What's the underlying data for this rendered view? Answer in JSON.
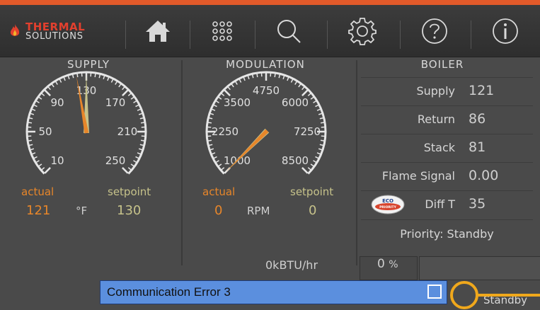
{
  "brand": {
    "line1": "THERMAL",
    "line2": "SOLUTIONS"
  },
  "nav": [
    {
      "name": "home-icon"
    },
    {
      "name": "apps-grid-icon"
    },
    {
      "name": "search-icon"
    },
    {
      "name": "gear-icon"
    },
    {
      "name": "help-icon"
    },
    {
      "name": "info-icon"
    }
  ],
  "supply": {
    "title": "SUPPLY",
    "ticks": [
      "10",
      "50",
      "90",
      "130",
      "170",
      "210",
      "250"
    ],
    "actual_label": "actual",
    "setpoint_label": "setpoint",
    "actual_value": "121",
    "unit": "°F",
    "setpoint_value": "130",
    "actual": 121,
    "setpoint": 130,
    "min": 10,
    "max": 250
  },
  "modulation": {
    "title": "MODULATION",
    "ticks": [
      "1000",
      "2250",
      "3500",
      "4750",
      "6000",
      "7250",
      "8500"
    ],
    "actual_label": "actual",
    "setpoint_label": "setpoint",
    "actual_value": "0",
    "unit": "RPM",
    "setpoint_value": "0",
    "actual": 0,
    "setpoint": 0,
    "min": 1000,
    "max": 8500
  },
  "boiler": {
    "title": "BOILER",
    "rows": [
      {
        "label": "Supply",
        "value": "121"
      },
      {
        "label": "Return",
        "value": "86"
      },
      {
        "label": "Stack",
        "value": "81"
      },
      {
        "label": "Flame Signal",
        "value": "0.00"
      },
      {
        "label": "Diff T",
        "value": "35"
      }
    ],
    "eco_badge_top": "ECO",
    "eco_badge_bottom": "PRIORITY",
    "priority": "Priority: Standby"
  },
  "status": {
    "btu": "0kBTU/hr",
    "percent_value": "0",
    "percent_unit": "%",
    "error": "Communication Error 3",
    "state": "Standby"
  },
  "colors": {
    "accent": "#e25a2a",
    "actual": "#e7862a",
    "setpoint": "#c6c28a",
    "error_bar": "#5b8fde",
    "highlight_ring": "#f0a81c"
  }
}
